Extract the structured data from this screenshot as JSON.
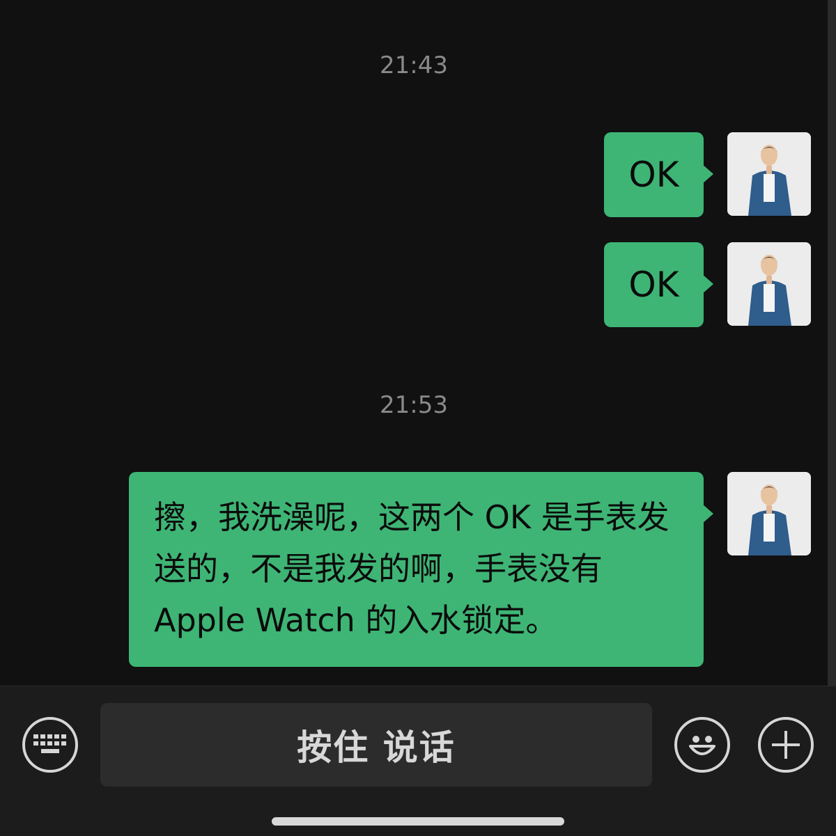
{
  "chat": {
    "messages": [
      {
        "type": "time",
        "text": "21:43"
      },
      {
        "type": "sent",
        "text": "OK"
      },
      {
        "type": "sent",
        "text": "OK"
      },
      {
        "type": "time",
        "text": "21:53"
      },
      {
        "type": "sent",
        "text": "擦，我洗澡呢，这两个 OK 是手表发送的，不是我发的啊，手表没有 Apple Watch 的入水锁定。"
      }
    ]
  },
  "input_bar": {
    "voice_mode_icon": "keyboard-icon",
    "hold_to_talk_label": "按住 说话",
    "emoji_icon": "smiley-icon",
    "more_icon": "plus-icon"
  },
  "colors": {
    "background": "#111111",
    "bubble_sent": "#3eb575",
    "timestamp": "#8a8a8a",
    "input_bar": "#1c1c1c"
  }
}
